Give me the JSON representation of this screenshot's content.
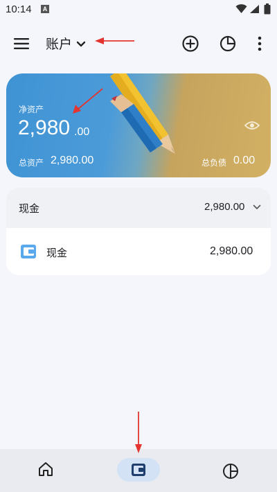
{
  "status_bar": {
    "time": "10:14",
    "notification_badge": "A",
    "icons": [
      "wifi-icon",
      "signal-icon",
      "battery-icon"
    ]
  },
  "app_bar": {
    "title": "账户",
    "icons": [
      "menu-icon",
      "chevron-down-icon",
      "add-circle-icon",
      "pie-chart-icon",
      "more-vertical-icon"
    ]
  },
  "asset_card": {
    "net_assets_label": "净资产",
    "net_assets_integer": "2,980",
    "net_assets_decimal": ".00",
    "total_assets_label": "总资产",
    "total_assets_value": "2,980.00",
    "total_debt_label": "总负债",
    "total_debt_value": "0.00",
    "visibility_icon": "eye-icon"
  },
  "account_group": {
    "name": "现金",
    "total": "2,980.00",
    "accounts": [
      {
        "name": "现金",
        "balance": "2,980.00",
        "icon": "wallet-icon"
      }
    ]
  },
  "bottom_nav": {
    "items": [
      {
        "icon": "home-icon",
        "selected": false
      },
      {
        "icon": "wallet-icon",
        "selected": true
      },
      {
        "icon": "pie-chart-icon",
        "selected": false
      }
    ]
  },
  "colors": {
    "background": "#f5f6fb",
    "card_blue": "#4a9ad9",
    "card_gold": "#cfae62",
    "nav_selected_pill": "#d3e2f5",
    "wallet_icon_blue": "#5aa9ec",
    "annotation_red": "#e3342f"
  }
}
